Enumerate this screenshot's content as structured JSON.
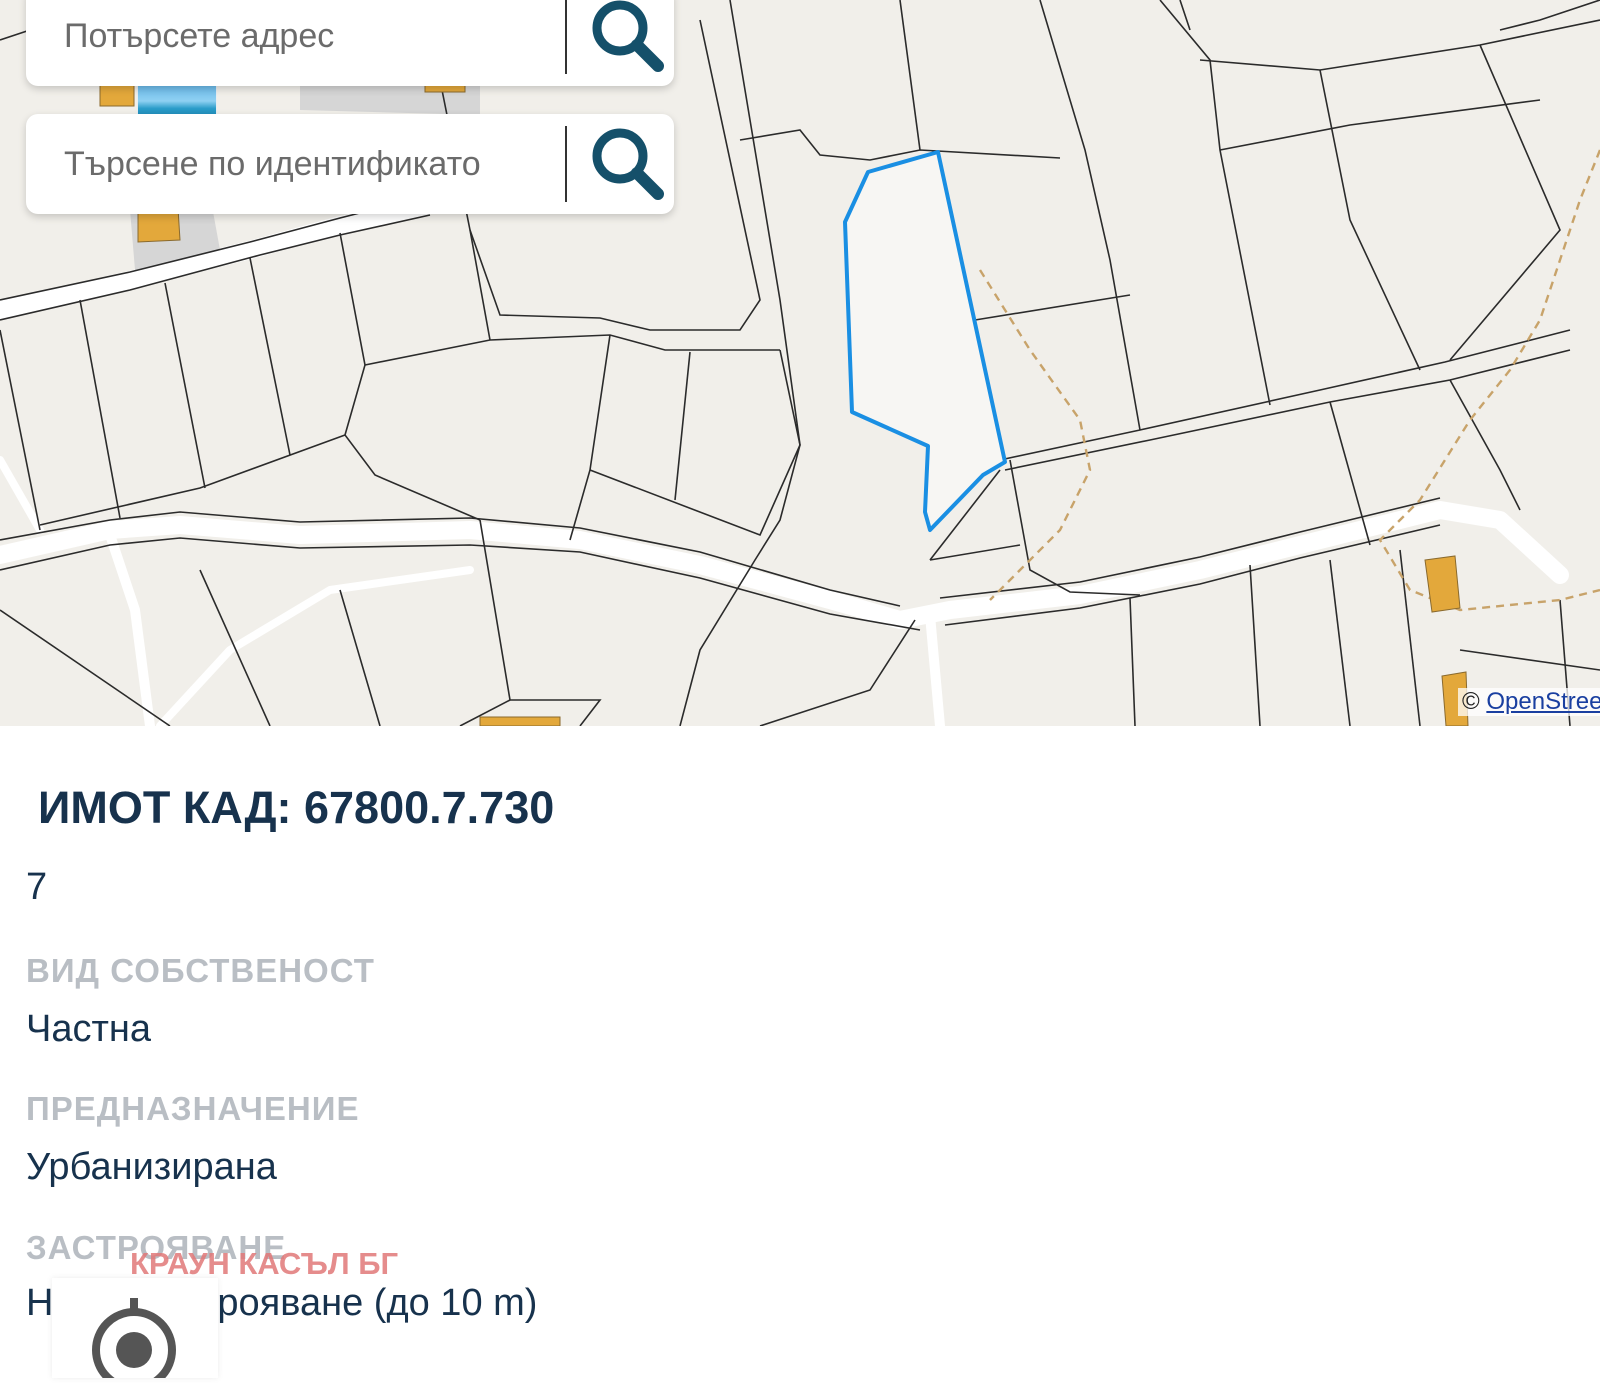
{
  "search": {
    "address_placeholder": "Потърсете адрес",
    "id_placeholder": "Търсене по идентификато"
  },
  "map": {
    "attribution_prefix": "©",
    "attribution_link": "OpenStree",
    "selected_parcel_color": "#1a8fe3",
    "background_color": "#f1efea",
    "building_color": "#e3a83b"
  },
  "property": {
    "title": "ИМОТ КАД: 67800.7.730",
    "number": "7",
    "fields": [
      {
        "label": "ВИД СОБСТВЕНОСТ",
        "value": "Частна"
      },
      {
        "label": "ПРЕДНАЗНАЧЕНИЕ",
        "value": "Урбанизирана"
      },
      {
        "label": "ЗАСТРОЯВАНЕ",
        "value": "Ниско застрояване (до 10 m)"
      }
    ]
  },
  "watermark": "КРАУН КАСЪЛ БГ",
  "colors": {
    "title": "#17324d",
    "label": "#b9bec4",
    "icon": "#15506a"
  }
}
